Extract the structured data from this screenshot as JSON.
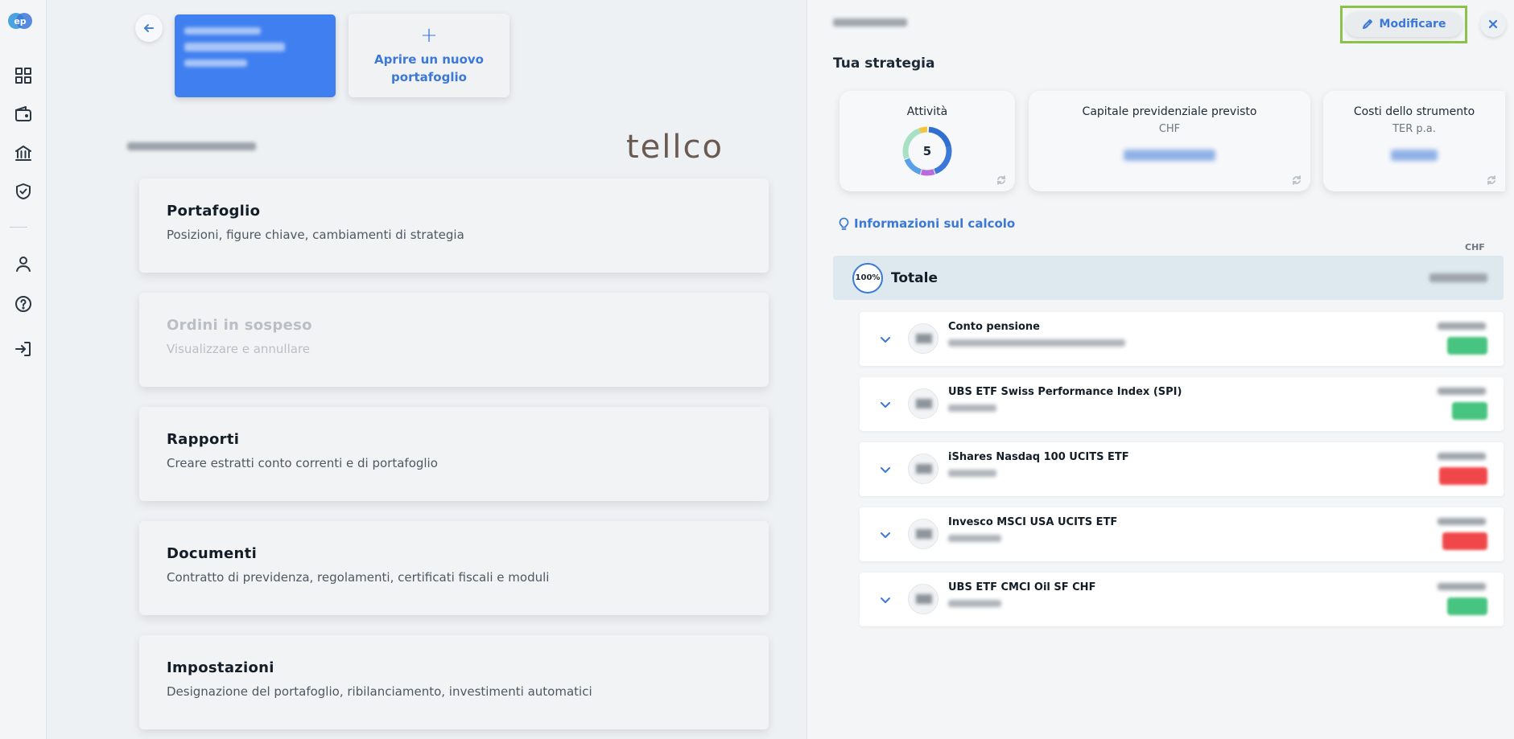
{
  "sidebar": {
    "logo_text": "ep",
    "items": [
      {
        "name": "dashboard-icon"
      },
      {
        "name": "wallet-icon"
      },
      {
        "name": "bank-icon"
      },
      {
        "name": "shield-check-icon"
      },
      {
        "name": "user-icon"
      },
      {
        "name": "help-icon"
      },
      {
        "name": "logout-icon"
      }
    ]
  },
  "left": {
    "new_portfolio_label": "Aprire un nuovo portafoglio",
    "brand": "tellco",
    "menu": [
      {
        "title": "Portafoglio",
        "subtitle": "Posizioni, figure chiave, cambiamenti di strategia",
        "enabled": true
      },
      {
        "title": "Ordini in sospeso",
        "subtitle": "Visualizzare e annullare",
        "enabled": false
      },
      {
        "title": "Rapporti",
        "subtitle": "Creare estratti conto correnti e di portafoglio",
        "enabled": true
      },
      {
        "title": "Documenti",
        "subtitle": "Contratto di previdenza, regolamenti, certificati fiscali e moduli",
        "enabled": true
      },
      {
        "title": "Impostazioni",
        "subtitle": "Designazione del portafoglio, ribilanciamento, investimenti automatici",
        "enabled": true
      }
    ]
  },
  "right": {
    "edit_label": "Modificare",
    "section_title": "Tua strategia",
    "kpis": {
      "activities": {
        "title": "Attività",
        "count": "5"
      },
      "capital": {
        "title": "Capitale previdenziale previsto",
        "subtitle": "CHF"
      },
      "costs": {
        "title": "Costi dello strumento",
        "subtitle": "TER p.a."
      }
    },
    "info_link": "Informazioni sul calcolo",
    "currency": "CHF",
    "total": {
      "percent": "100%",
      "label": "Totale"
    },
    "assets": [
      {
        "name": "Conto pensione",
        "trend": "positive"
      },
      {
        "name": "UBS ETF Swiss Performance Index (SPI)",
        "trend": "positive"
      },
      {
        "name": "iShares Nasdaq 100 UCITS ETF",
        "trend": "negative"
      },
      {
        "name": "Invesco MSCI USA UCITS ETF",
        "trend": "negative"
      },
      {
        "name": "UBS ETF CMCI Oil SF CHF",
        "trend": "positive"
      }
    ],
    "colors": {
      "accent": "#3c78d8",
      "positive": "#47c47f",
      "negative": "#f0484a",
      "highlight": "#8bc34a"
    }
  }
}
